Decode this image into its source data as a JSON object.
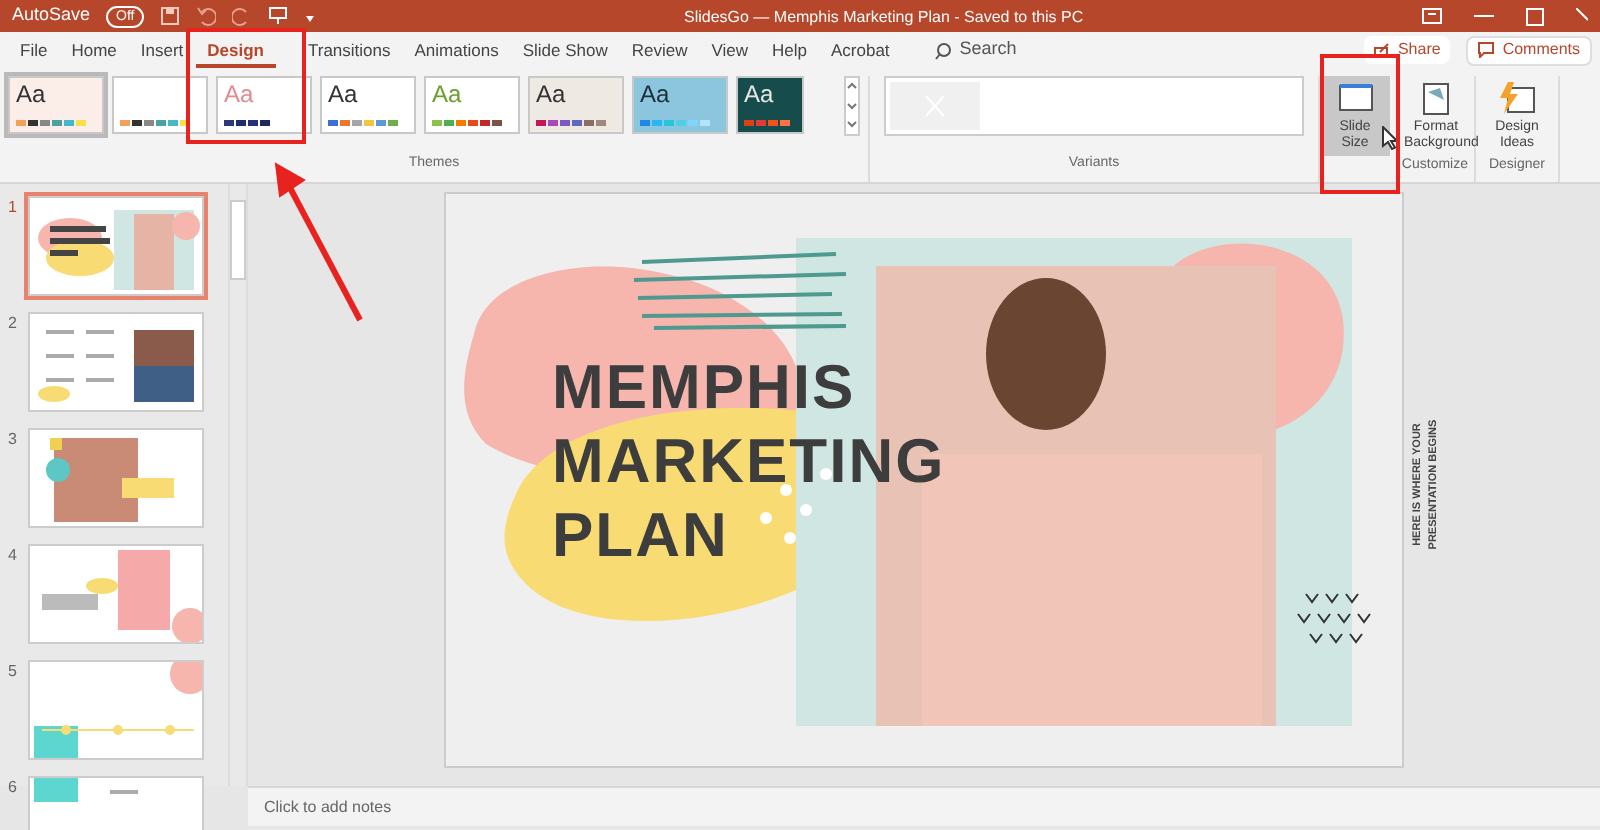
{
  "title_bar": {
    "autosave_label": "AutoSave",
    "autosave_toggle": {
      "label": "Off",
      "on": false
    },
    "title": "SlidesGo — Memphis Marketing Plan  -  Saved to this PC"
  },
  "tabs": [
    {
      "label": "File",
      "selected": false
    },
    {
      "label": "Home",
      "selected": false
    },
    {
      "label": "Insert",
      "selected": false
    },
    {
      "label": "Design",
      "selected": true
    },
    {
      "label": "Transitions",
      "selected": false
    },
    {
      "label": "Animations",
      "selected": false
    },
    {
      "label": "Slide Show",
      "selected": false
    },
    {
      "label": "Review",
      "selected": false
    },
    {
      "label": "View",
      "selected": false
    },
    {
      "label": "Help",
      "selected": false
    },
    {
      "label": "Acrobat",
      "selected": false
    }
  ],
  "search": {
    "placeholder": "Search"
  },
  "share_button": {
    "label": "Share"
  },
  "comments_button": {
    "label": "Comments"
  },
  "themes": {
    "label": "Themes",
    "items": [
      {
        "text": "Aa",
        "selected": true
      },
      {
        "selected": false
      },
      {
        "text": "Aa",
        "selected": false
      },
      {
        "text": "Aa",
        "selected": false
      },
      {
        "text": "Aa",
        "selected": false
      },
      {
        "text": "Aa",
        "selected": false
      },
      {
        "text": "Aa",
        "selected": false
      },
      {
        "text": "Aa",
        "selected": false
      }
    ]
  },
  "variants": {
    "label": "Variants"
  },
  "customize": {
    "label": "Customize",
    "buttons": [
      {
        "label": "Slide Size",
        "selected": true
      },
      {
        "label": "Format Background",
        "selected": false
      }
    ]
  },
  "designer": {
    "label": "Designer",
    "buttons": [
      {
        "label": "Design Ideas"
      }
    ]
  },
  "slides": [
    {
      "number": "1",
      "selected": true
    },
    {
      "number": "2",
      "selected": false
    },
    {
      "number": "3",
      "selected": false
    },
    {
      "number": "4",
      "selected": false
    },
    {
      "number": "5",
      "selected": false
    },
    {
      "number": "6",
      "selected": false
    }
  ],
  "slide": {
    "title_lines": [
      "MEMPHIS",
      "MARKETING",
      "PLAN"
    ],
    "side_text": "HERE IS WHERE YOUR PRESENTATION BEGINS"
  },
  "notes": {
    "placeholder": "Click to add notes"
  },
  "annotations": [
    {
      "kind": "box"
    },
    {
      "kind": "box"
    },
    {
      "kind": "arrow"
    }
  ]
}
